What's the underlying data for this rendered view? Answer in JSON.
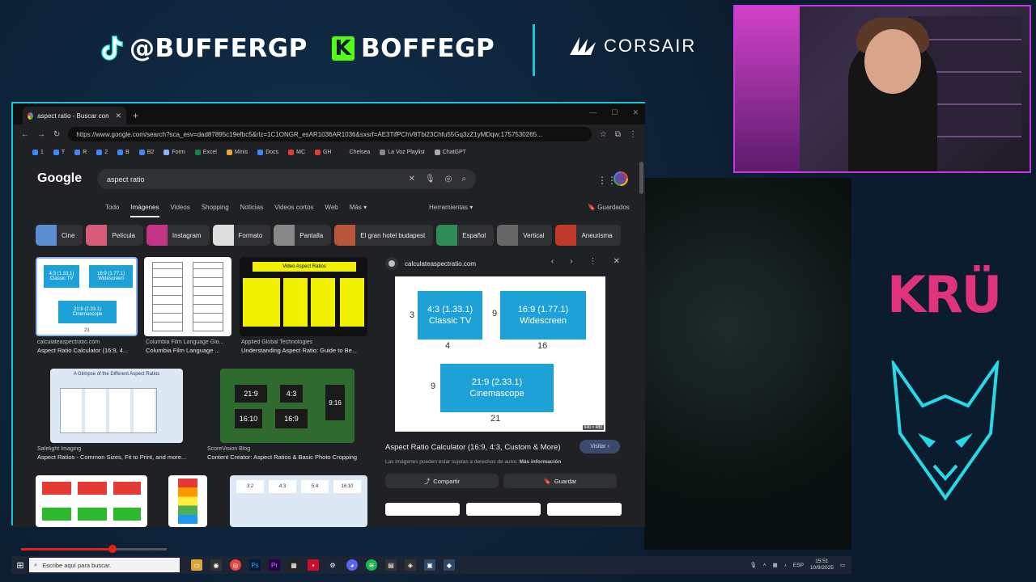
{
  "overlay": {
    "tiktok_handle": "@BUFFERGP",
    "kick_handle": "BOFFEGP",
    "sponsor": "CORSAIR",
    "team_logo_text": "KRÜ"
  },
  "browser": {
    "tab_title": "aspect ratio - Buscar con Google",
    "url": "https://www.google.com/search?sca_esv=dad87895c19efbc5&rlz=1C1ONGR_esAR1036AR1036&sxsrf=AE3TifPChV8Tbi23Chfu55Gq3zZ1yMDqw:1757530265...",
    "bookmarks": [
      {
        "label": "1",
        "color": "#4285f4"
      },
      {
        "label": "T",
        "color": "#4285f4"
      },
      {
        "label": "R",
        "color": "#4285f4"
      },
      {
        "label": "2",
        "color": "#4285f4"
      },
      {
        "label": "B",
        "color": "#4285f4"
      },
      {
        "label": "B2",
        "color": "#4285f4"
      },
      {
        "label": "Form",
        "color": "#8ab4f8"
      },
      {
        "label": "Excel",
        "color": "#1e7e45"
      },
      {
        "label": "Minis",
        "color": "#e8a33c"
      },
      {
        "label": "Docs",
        "color": "#4285f4"
      },
      {
        "label": "MC",
        "color": "#e53935"
      },
      {
        "label": "GH",
        "color": "#e53935"
      },
      {
        "label": "Chelsea",
        "color": "#222"
      },
      {
        "label": "La Voz Playlist",
        "color": "#888"
      },
      {
        "label": "ChatGPT",
        "color": "#aaa"
      }
    ]
  },
  "google": {
    "logo": "Google",
    "query": "aspect ratio",
    "filters": [
      "Todo",
      "Imágenes",
      "Videos",
      "Shopping",
      "Noticias",
      "Videos cortos",
      "Web",
      "Más ▾"
    ],
    "active_filter": "Imágenes",
    "tools": "Herramientas ▾",
    "saved": "Guardados",
    "chips": [
      {
        "label": "Cine",
        "color": "#5a8ed1"
      },
      {
        "label": "Película",
        "color": "#d65a7a"
      },
      {
        "label": "Instagram",
        "color": "#c13584"
      },
      {
        "label": "Formato",
        "color": "#ddd"
      },
      {
        "label": "Pantalla",
        "color": "#888"
      },
      {
        "label": "El gran hotel budapest",
        "color": "#b8563a"
      },
      {
        "label": "Español",
        "color": "#2e8b57"
      },
      {
        "label": "Vertical",
        "color": "#666"
      },
      {
        "label": "Aneurisma",
        "color": "#c0392b"
      }
    ],
    "results": [
      {
        "source": "calculateaspectratio.com",
        "title": "Aspect Ratio Calculator (16:9, 4..."
      },
      {
        "source": "Columbia Film Language Glo...",
        "title": "Columbia Film Language ..."
      },
      {
        "source": "Applied Global Technologies",
        "title": "Understanding Aspect Ratio: Guide to Be..."
      },
      {
        "source": "Safelight Imaging",
        "title": "Aspect Ratios - Common Sizes, Fit to Print, and more..."
      },
      {
        "source": "ScoreVision Blog",
        "title": "Content Creator: Aspect Ratios & Basic Photo Cropping"
      }
    ],
    "thumb_text": {
      "t1a": "4:3 (1.33.1)",
      "t1b": "Classic TV",
      "t1c": "16:9 (1.77.1)",
      "t1d": "Widescreen",
      "t1e": "21:9 (2.33.1)",
      "t1f": "Cinemascope",
      "t1n": "21",
      "t3": "Video Aspect Ratios",
      "t4": "A Glimpse of the Different Aspect Ratios",
      "t5a": "21:9",
      "t5b": "4:3",
      "t5c": "9:16",
      "t5d": "16:10",
      "t5e": "16:9",
      "t8a": "3:2",
      "t8b": "4:3",
      "t8c": "5:4",
      "t8d": "16:10"
    },
    "preview": {
      "site": "calculateaspectratio.com",
      "box1_ratio": "4:3 (1.33.1)",
      "box1_name": "Classic TV",
      "box2_ratio": "16:9 (1.77.1)",
      "box2_name": "Widescreen",
      "box3_ratio": "21:9 (2.33.1)",
      "box3_name": "Cinemascope",
      "n_3": "3",
      "n_4": "4",
      "n_9a": "9",
      "n_16": "16",
      "n_9b": "9",
      "n_21": "21",
      "dimensions": "640 × 480",
      "title": "Aspect Ratio Calculator (16:9, 4:3, Custom & More)",
      "visit": "Visitar ›",
      "rights": "Las imágenes pueden estar sujetas a derechos de autor.",
      "more_info": "Más información",
      "share": "Compartir",
      "save": "Guardar"
    }
  },
  "video_progress": 0.63,
  "taskbar": {
    "search_placeholder": "Escribe aquí para buscar.",
    "lang": "ESP",
    "time": "15:51",
    "date": "10/9/2025"
  }
}
